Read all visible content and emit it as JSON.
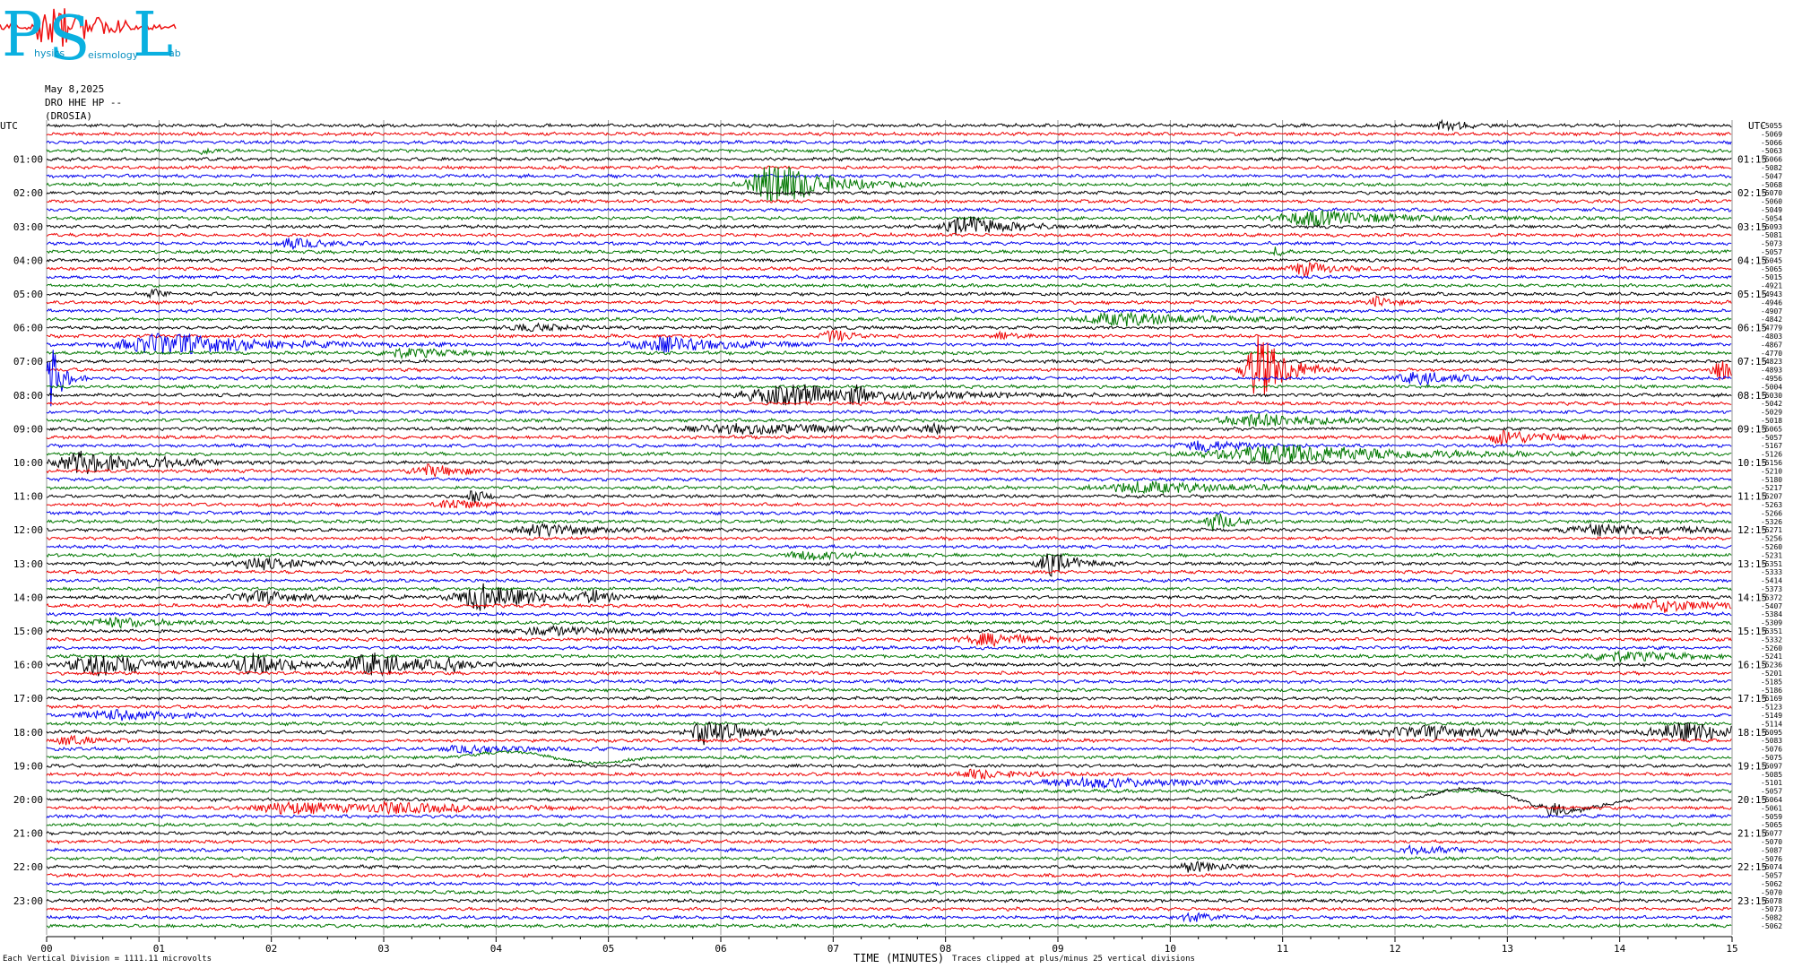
{
  "logo": {
    "letters": [
      "P",
      "S",
      "L"
    ],
    "words": [
      "hysics",
      "eismology",
      "ab"
    ]
  },
  "header": {
    "date": "May 8,2025",
    "station": "DRO HHE HP --",
    "location": "(DROSIA)"
  },
  "footer": {
    "scale_note": "Each Vertical Division = 1111.11 microvolts",
    "clip_note": "Traces clipped at plus/minus 25 vertical divisions"
  },
  "colors": {
    "traces": [
      "#000000",
      "#ee0000",
      "#0000ee",
      "#007700"
    ],
    "grid": "#808080",
    "logo": "#0ab0e0",
    "logo_signal": "#ee1111"
  },
  "chart_data": {
    "type": "helicorder",
    "xlabel": "TIME (MINUTES)",
    "xlim": [
      0,
      15
    ],
    "x_ticks": [
      "00",
      "01",
      "02",
      "03",
      "04",
      "05",
      "06",
      "07",
      "08",
      "09",
      "10",
      "11",
      "12",
      "13",
      "14",
      "15"
    ],
    "axis_label_left": "UTC",
    "axis_label_right": "UTC",
    "line_minutes": 15,
    "line_count": 96,
    "left_hour_labels": [
      "01:00",
      "02:00",
      "03:00",
      "04:00",
      "05:00",
      "06:00",
      "07:00",
      "08:00",
      "09:00",
      "10:00",
      "11:00",
      "12:00",
      "13:00",
      "14:00",
      "15:00",
      "16:00",
      "17:00",
      "18:00",
      "19:00",
      "20:00",
      "21:00",
      "22:00",
      "23:00"
    ],
    "right_hour_labels": [
      "01:15",
      "02:15",
      "03:15",
      "04:15",
      "05:15",
      "06:15",
      "07:15",
      "08:15",
      "09:15",
      "10:15",
      "11:15",
      "12:15",
      "13:15",
      "14:15",
      "15:15",
      "16:15",
      "17:15",
      "18:15",
      "19:15",
      "20:15",
      "21:15",
      "22:15",
      "23:15"
    ],
    "trace_offsets": [
      -5055,
      -5069,
      -5066,
      -5063,
      -5066,
      -5082,
      -5047,
      -5068,
      -5070,
      -5060,
      -5049,
      -5054,
      -5093,
      -5081,
      -5073,
      -5057,
      -5045,
      -5065,
      -5015,
      -4921,
      -4943,
      -4946,
      -4907,
      -4842,
      -4779,
      -4803,
      -4867,
      -4770,
      -4823,
      -4893,
      -4956,
      -5004,
      -5030,
      -5042,
      -5029,
      -5018,
      -5065,
      -5057,
      -5167,
      -5126,
      -5156,
      -5210,
      -5180,
      -5217,
      -5207,
      -5263,
      -5266,
      -5326,
      -5271,
      -5256,
      -5260,
      -5231,
      -5351,
      -5333,
      -5414,
      -5373,
      -5372,
      -5407,
      -5384,
      -5309,
      -5351,
      -5332,
      -5260,
      -5241,
      -5236,
      -5201,
      -5185,
      -5186,
      -5169,
      -5123,
      -5149,
      -5114,
      -5095,
      -5083,
      -5076,
      -5075,
      -5097,
      -5085,
      -5101,
      -5057,
      -5064,
      -5061,
      -5059,
      -5065,
      -5077,
      -5070,
      -5087,
      -5076,
      -5074,
      -5057,
      -5062,
      -5070,
      -5078,
      -5073,
      -5082,
      -5062
    ],
    "events": [
      {
        "line": 0,
        "minute": 12.45,
        "amp": 7,
        "width": 0.12
      },
      {
        "line": 3,
        "minute": 1.4,
        "amp": 4,
        "width": 0.08
      },
      {
        "line": 7,
        "minute": 6.5,
        "amp": 26,
        "width": 0.35
      },
      {
        "line": 11,
        "minute": 11.3,
        "amp": 8,
        "width": 0.6
      },
      {
        "line": 12,
        "minute": 8.2,
        "amp": 12,
        "width": 0.3
      },
      {
        "line": 14,
        "minute": 2.2,
        "amp": 5,
        "width": 0.25
      },
      {
        "line": 15,
        "minute": 10.95,
        "amp": 6,
        "width": 0.05
      },
      {
        "line": 17,
        "minute": 11.2,
        "amp": 8,
        "width": 0.2
      },
      {
        "line": 20,
        "minute": 0.95,
        "amp": 6,
        "width": 0.08
      },
      {
        "line": 21,
        "minute": 11.85,
        "amp": 6,
        "width": 0.12
      },
      {
        "line": 23,
        "minute": 9.6,
        "amp": 7,
        "width": 0.6
      },
      {
        "line": 24,
        "minute": 4.3,
        "amp": 4,
        "width": 0.25
      },
      {
        "line": 25,
        "minute": 7.0,
        "amp": 7,
        "width": 0.15
      },
      {
        "line": 25,
        "minute": 8.5,
        "amp": 5,
        "width": 0.1
      },
      {
        "line": 26,
        "minute": 1.1,
        "amp": 12,
        "width": 0.7
      },
      {
        "line": 26,
        "minute": 5.5,
        "amp": 8,
        "width": 0.5
      },
      {
        "line": 27,
        "minute": 3.2,
        "amp": 5,
        "width": 0.35
      },
      {
        "line": 29,
        "minute": 10.8,
        "amp": 40,
        "width": 0.2
      },
      {
        "line": 29,
        "minute": 14.9,
        "amp": 12,
        "width": 0.15
      },
      {
        "line": 30,
        "minute": 0.05,
        "amp": 35,
        "width": 0.08
      },
      {
        "line": 30,
        "minute": 12.2,
        "amp": 7,
        "width": 0.3
      },
      {
        "line": 32,
        "minute": 6.7,
        "amp": 11,
        "width": 0.8
      },
      {
        "line": 32,
        "minute": 7.2,
        "amp": 12,
        "width": 0.15
      },
      {
        "line": 35,
        "minute": 10.8,
        "amp": 7,
        "width": 0.6
      },
      {
        "line": 36,
        "minute": 6.3,
        "amp": 5,
        "width": 0.9
      },
      {
        "line": 36,
        "minute": 7.9,
        "amp": 5,
        "width": 0.2
      },
      {
        "line": 37,
        "minute": 13.0,
        "amp": 8,
        "width": 0.3
      },
      {
        "line": 38,
        "minute": 10.3,
        "amp": 6,
        "width": 0.3
      },
      {
        "line": 39,
        "minute": 11.0,
        "amp": 10,
        "width": 1.0
      },
      {
        "line": 40,
        "minute": 0.35,
        "amp": 12,
        "width": 0.4
      },
      {
        "line": 40,
        "minute": 1.0,
        "amp": 6,
        "width": 0.3
      },
      {
        "line": 41,
        "minute": 3.4,
        "amp": 6,
        "width": 0.3
      },
      {
        "line": 43,
        "minute": 9.8,
        "amp": 6,
        "width": 0.7
      },
      {
        "line": 44,
        "minute": 3.8,
        "amp": 8,
        "width": 0.08
      },
      {
        "line": 45,
        "minute": 3.6,
        "amp": 6,
        "width": 0.2
      },
      {
        "line": 47,
        "minute": 10.4,
        "amp": 10,
        "width": 0.15
      },
      {
        "line": 48,
        "minute": 4.4,
        "amp": 7,
        "width": 0.4
      },
      {
        "line": 48,
        "minute": 13.9,
        "amp": 6,
        "width": 0.6
      },
      {
        "line": 51,
        "minute": 6.8,
        "amp": 5,
        "width": 0.3
      },
      {
        "line": 52,
        "minute": 8.95,
        "amp": 12,
        "width": 0.2
      },
      {
        "line": 52,
        "minute": 1.9,
        "amp": 6,
        "width": 0.4
      },
      {
        "line": 56,
        "minute": 3.9,
        "amp": 14,
        "width": 0.4
      },
      {
        "line": 56,
        "minute": 4.85,
        "amp": 8,
        "width": 0.15
      },
      {
        "line": 56,
        "minute": 1.9,
        "amp": 6,
        "width": 0.4
      },
      {
        "line": 57,
        "minute": 14.4,
        "amp": 6,
        "width": 0.4
      },
      {
        "line": 59,
        "minute": 0.6,
        "amp": 5,
        "width": 0.4
      },
      {
        "line": 60,
        "minute": 4.5,
        "amp": 4,
        "width": 0.6
      },
      {
        "line": 61,
        "minute": 8.4,
        "amp": 6,
        "width": 0.4
      },
      {
        "line": 63,
        "minute": 14.0,
        "amp": 5,
        "width": 0.5
      },
      {
        "line": 64,
        "minute": 0.5,
        "amp": 12,
        "width": 0.45
      },
      {
        "line": 64,
        "minute": 1.85,
        "amp": 12,
        "width": 0.3
      },
      {
        "line": 64,
        "minute": 2.9,
        "amp": 14,
        "width": 0.35
      },
      {
        "line": 64,
        "minute": 3.6,
        "amp": 8,
        "width": 0.15
      },
      {
        "line": 70,
        "minute": 0.6,
        "amp": 5,
        "width": 0.5
      },
      {
        "line": 72,
        "minute": 5.9,
        "amp": 16,
        "width": 0.25
      },
      {
        "line": 72,
        "minute": 14.6,
        "amp": 10,
        "width": 0.5
      },
      {
        "line": 72,
        "minute": 12.3,
        "amp": 6,
        "width": 0.7
      },
      {
        "line": 73,
        "minute": 0.2,
        "amp": 5,
        "width": 0.2
      },
      {
        "line": 74,
        "minute": 3.8,
        "amp": 4,
        "width": 0.4
      },
      {
        "line": 77,
        "minute": 8.3,
        "amp": 5,
        "width": 0.3
      },
      {
        "line": 78,
        "minute": 9.3,
        "amp": 5,
        "width": 0.7
      },
      {
        "line": 81,
        "minute": 2.2,
        "amp": 6,
        "width": 0.6
      },
      {
        "line": 81,
        "minute": 3.1,
        "amp": 6,
        "width": 0.6
      },
      {
        "line": 80,
        "minute": 13.4,
        "amp": 8,
        "width": 0.12
      },
      {
        "line": 86,
        "minute": 12.2,
        "amp": 4,
        "width": 0.3
      },
      {
        "line": 88,
        "minute": 10.2,
        "amp": 6,
        "width": 0.2
      },
      {
        "line": 94,
        "minute": 10.2,
        "amp": 5,
        "width": 0.2
      }
    ],
    "swells": [
      {
        "line": 75,
        "start": 3.5,
        "end": 5.5,
        "amp": 8
      },
      {
        "line": 80,
        "start": 12.0,
        "end": 14.2,
        "amp": 16
      }
    ]
  }
}
